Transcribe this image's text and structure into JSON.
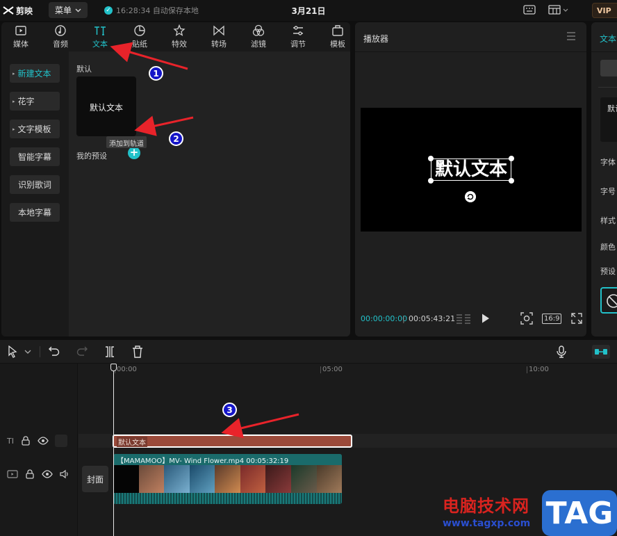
{
  "app": {
    "logo_text": "剪映",
    "menu_label": "菜单",
    "save_status": "16:28:34 自动保存本地",
    "project_title": "3月21日",
    "vip_label": "VIP"
  },
  "tabs": [
    {
      "label": "媒体",
      "icon": "media-icon",
      "active": false
    },
    {
      "label": "音频",
      "icon": "audio-icon",
      "active": false
    },
    {
      "label": "文本",
      "icon": "text-icon",
      "active": true
    },
    {
      "label": "贴纸",
      "icon": "sticker-icon",
      "active": false
    },
    {
      "label": "特效",
      "icon": "effects-icon",
      "active": false
    },
    {
      "label": "转场",
      "icon": "transition-icon",
      "active": false
    },
    {
      "label": "滤镜",
      "icon": "filter-icon",
      "active": false
    },
    {
      "label": "调节",
      "icon": "adjust-icon",
      "active": false
    },
    {
      "label": "模板",
      "icon": "template-icon",
      "active": false
    }
  ],
  "categories": [
    {
      "label": "新建文本",
      "expandable": true,
      "active": true
    },
    {
      "label": "花字",
      "expandable": true,
      "active": false
    },
    {
      "label": "文字模板",
      "expandable": true,
      "active": false
    },
    {
      "label": "智能字幕",
      "expandable": false,
      "active": false
    },
    {
      "label": "识别歌词",
      "expandable": false,
      "active": false
    },
    {
      "label": "本地字幕",
      "expandable": false,
      "active": false
    }
  ],
  "content": {
    "section_default": "默认",
    "template_label": "默认文本",
    "add_tooltip": "添加到轨道",
    "section_my_presets": "我的预设"
  },
  "player": {
    "title": "播放器",
    "preview_text": "默认文本",
    "time_current": "00:00:00:00",
    "time_separator": "|",
    "time_total": "00:05:43:21",
    "ratio_label": "16:9"
  },
  "inspector": {
    "tab_label": "文本",
    "textbox_value": "默认",
    "labels": [
      "字体",
      "字号",
      "样式",
      "颜色",
      "预设"
    ]
  },
  "timeline": {
    "ruler_labels": [
      "00:00",
      "05:00",
      "10:00"
    ],
    "text_clip_label": "默认文本",
    "video_clip_label": "【MAMAMOO】MV- Wind Flower.mp4   00:05:32:19",
    "cover_label": "封面"
  },
  "annotations": [
    "1",
    "2",
    "3"
  ],
  "watermark": {
    "text": "电脑技术网",
    "url": "www.tagxp.com",
    "logo": "TAG"
  },
  "colors": {
    "accent": "#22c1c9",
    "text_clip": "#9b4a3a",
    "video_clip": "#1e5a5a",
    "arrow": "#e8232a",
    "badge": "#1515c8"
  }
}
